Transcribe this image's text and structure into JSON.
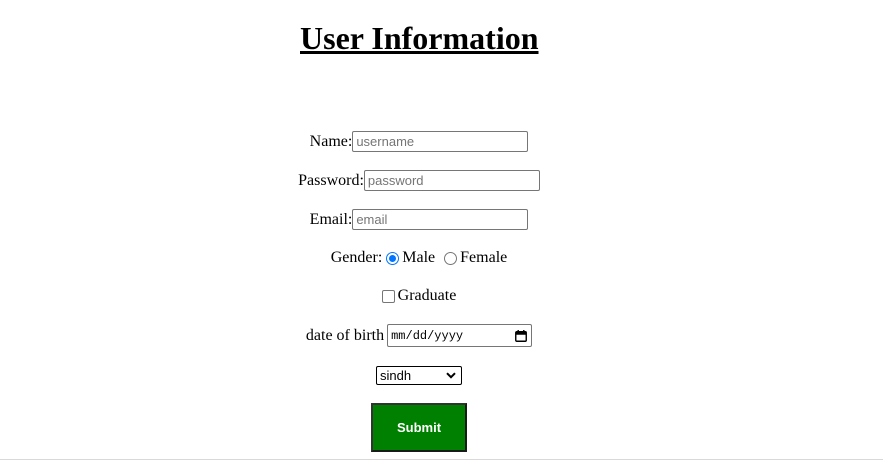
{
  "page": {
    "title": "User Information"
  },
  "form": {
    "name": {
      "label": "Name:",
      "value": "",
      "placeholder": "username"
    },
    "password": {
      "label": "Password:",
      "value": "",
      "placeholder": "password"
    },
    "email": {
      "label": "Email:",
      "value": "",
      "placeholder": "email"
    },
    "gender": {
      "label": "Gender:",
      "options": [
        {
          "label": "Male",
          "checked": true
        },
        {
          "label": "Female",
          "checked": false
        }
      ]
    },
    "graduate": {
      "label": "Graduate",
      "checked": false
    },
    "dob": {
      "label": "date of birth",
      "placeholder": "mm/dd/yyyy",
      "icon": "calendar-icon"
    },
    "province": {
      "selected": "sindh",
      "icon": "chevron-down-icon"
    },
    "submit": {
      "label": "Submit",
      "color": "#008000"
    }
  },
  "colors": {
    "accent": "#0075ff",
    "submit_bg": "#008000"
  }
}
